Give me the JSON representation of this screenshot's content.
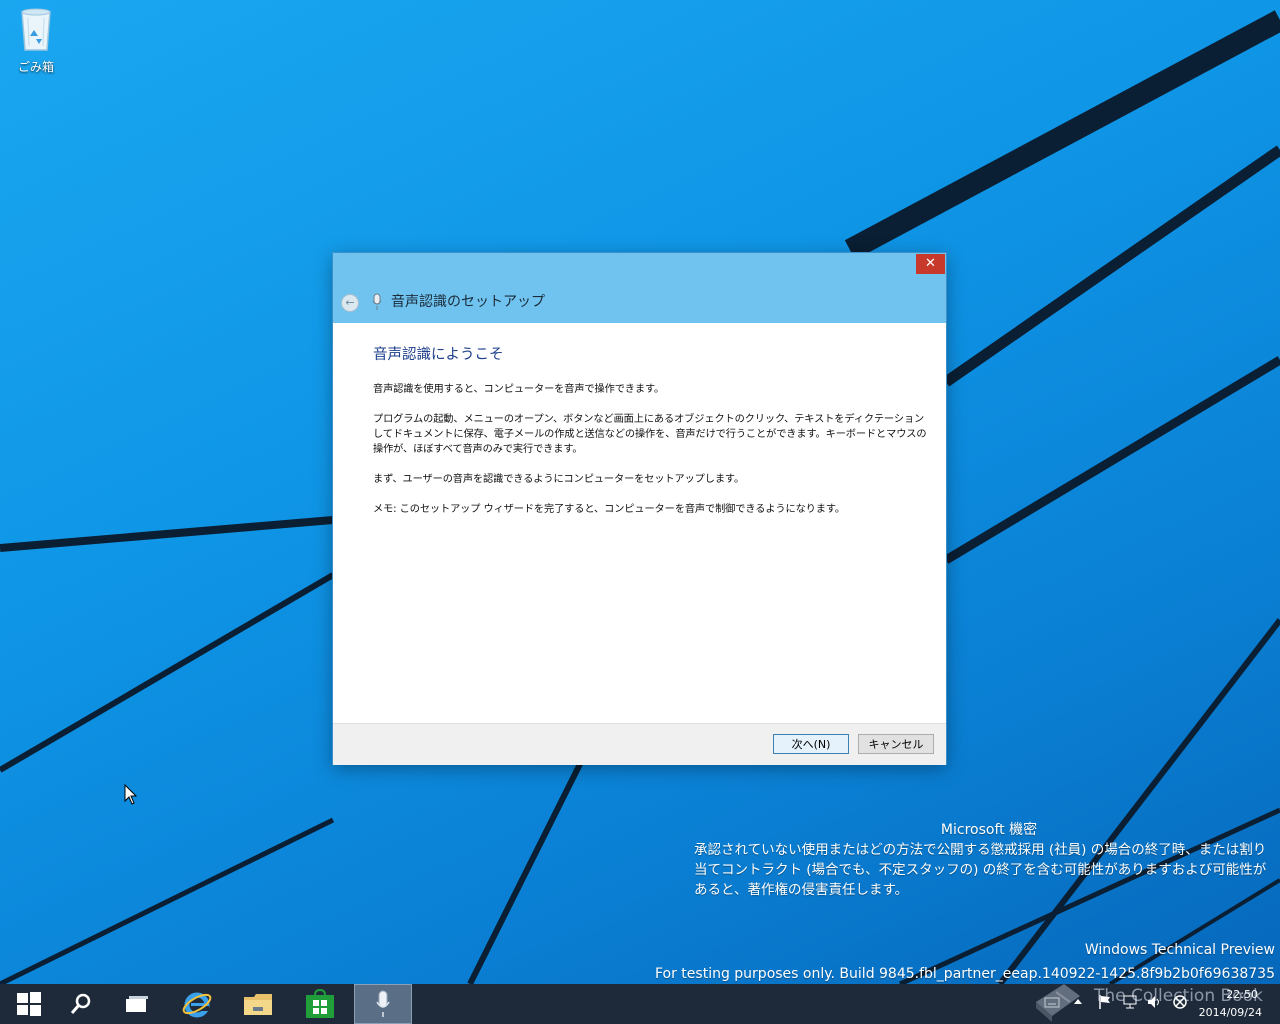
{
  "desktop": {
    "recycle_bin_label": "ごみ箱"
  },
  "watermark": {
    "title": "Microsoft 機密",
    "body": "承認されていない使用またはどの方法で公開する懲戒採用 (社員) の場合の終了時、または割り当てコントラクト (場合でも、不定スタッフの) の終了を含む可能性がありますおよび可能性があると、著作権の侵害責任します。",
    "product": "Windows Technical Preview",
    "build": "For testing purposes only. Build 9845.fbl_partner_eeap.140922-1425.8f9b2b0f69638735"
  },
  "dialog": {
    "title": "音声認識のセットアップ",
    "close_glyph": "✕",
    "back_glyph": "←",
    "heading": "音声認識にようこそ",
    "paragraphs": [
      "音声認識を使用すると、コンピューターを音声で操作できます。",
      "プログラムの起動、メニューのオープン、ボタンなど画面上にあるオブジェクトのクリック、テキストをディクテーションしてドキュメントに保存、電子メールの作成と送信などの操作を、音声だけで行うことができます。キーボードとマウスの操作が、ほぼすべて音声のみで実行できます。",
      "まず、ユーザーの音声を認識できるようにコンピューターをセットアップします。",
      "メモ: このセットアップ ウィザードを完了すると、コンピューターを音声で制御できるようになります。"
    ],
    "next_label": "次へ(N)",
    "cancel_label": "キャンセル"
  },
  "taskbar": {
    "items": [
      "start-icon",
      "search-icon",
      "task-view-icon",
      "internet-explorer-icon",
      "file-explorer-icon",
      "store-icon",
      "microphone-icon"
    ],
    "clock_time": "22:50",
    "clock_date": "2014/09/24"
  },
  "overlay": {
    "collection_text": "The Collection Book"
  },
  "colors": {
    "desktop": "#0f95e6",
    "dialog_titlebar": "#6fc3ee",
    "close_button": "#c7392b",
    "taskbar": "#1e2a3a",
    "heading": "#1e3f8c"
  }
}
